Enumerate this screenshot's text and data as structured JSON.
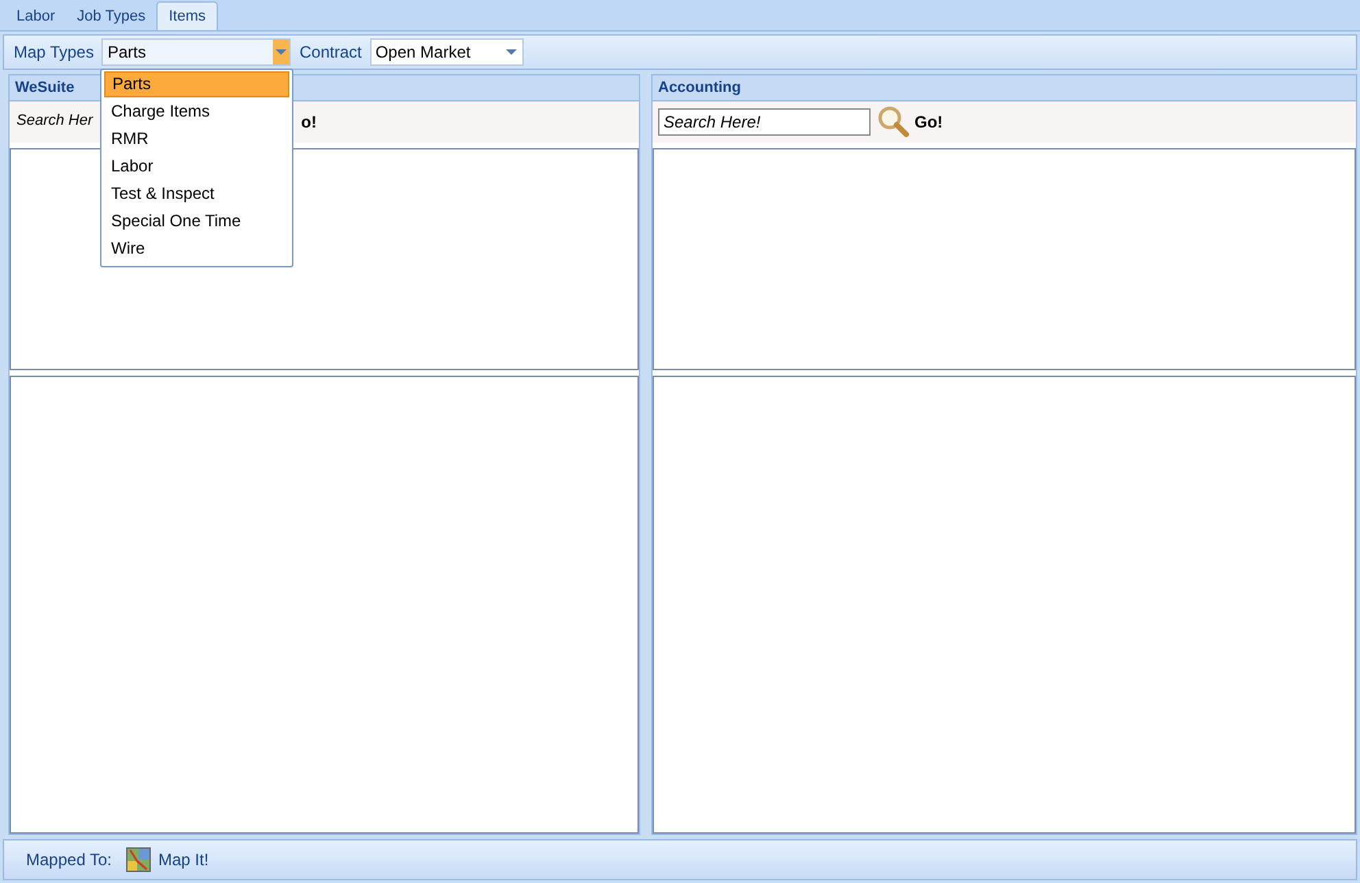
{
  "tabs": [
    {
      "label": "Labor",
      "selected": false
    },
    {
      "label": "Job Types",
      "selected": false
    },
    {
      "label": "Items",
      "selected": true
    }
  ],
  "toolbar": {
    "map_types_label": "Map Types",
    "map_types_value": "Parts",
    "contract_label": "Contract",
    "contract_value": "Open Market"
  },
  "dropdown": {
    "options": [
      {
        "label": "Parts",
        "selected": true
      },
      {
        "label": "Charge Items",
        "selected": false
      },
      {
        "label": "RMR",
        "selected": false
      },
      {
        "label": "Labor",
        "selected": false
      },
      {
        "label": "Test & Inspect",
        "selected": false
      },
      {
        "label": "Special One Time",
        "selected": false
      },
      {
        "label": "Wire",
        "selected": false
      }
    ]
  },
  "panels": [
    {
      "title": "WeSuite",
      "search_placeholder": "Search Her",
      "go": "o!"
    },
    {
      "title": "Accounting",
      "search_placeholder": "Search Here!",
      "go": "Go!"
    }
  ],
  "status_bar": {
    "mapped_to_label": "Mapped To:",
    "map_button": "Map It!"
  }
}
